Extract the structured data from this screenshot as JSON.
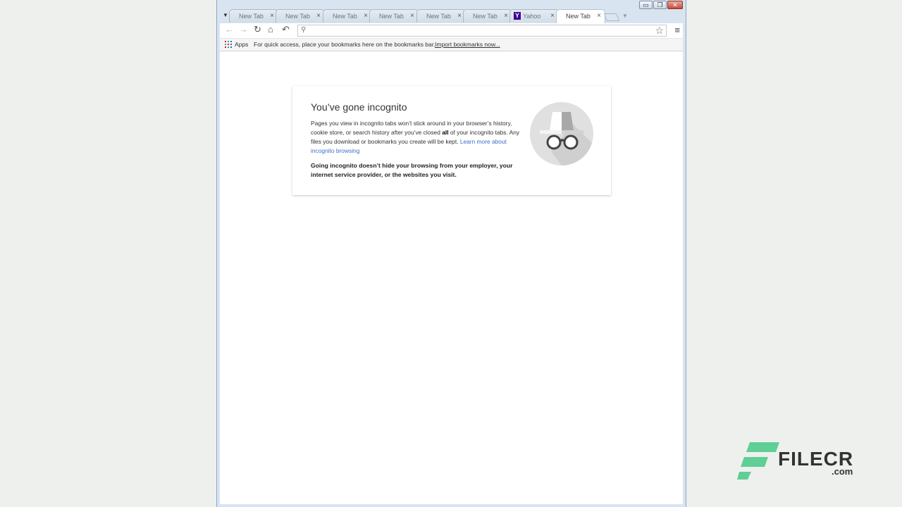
{
  "window": {
    "controls": {
      "minimize": "▭",
      "restore": "❐",
      "close": "✕"
    }
  },
  "tabs": [
    {
      "label": "New Tab",
      "close": "×",
      "active": false
    },
    {
      "label": "New Tab",
      "close": "×",
      "active": false
    },
    {
      "label": "New Tab",
      "close": "×",
      "active": false
    },
    {
      "label": "New Tab",
      "close": "×",
      "active": false
    },
    {
      "label": "New Tab",
      "close": "×",
      "active": false
    },
    {
      "label": "New Tab",
      "close": "×",
      "active": false
    },
    {
      "label": "Yahoo",
      "close": "×",
      "active": false,
      "favicon": "Y"
    },
    {
      "label": "New Tab",
      "close": "×",
      "active": true
    }
  ],
  "toolbar": {
    "back": "←",
    "forward": "→",
    "reload": "↻",
    "home": "⌂",
    "undo": "↶",
    "search_icon": "⚲",
    "star": "☆",
    "menu": "≡",
    "omnibox_value": ""
  },
  "bookmarks_bar": {
    "apps_label": "Apps",
    "hint": "For quick access, place your bookmarks here on the bookmarks bar.",
    "import_link": "Import bookmarks now..."
  },
  "incognito_card": {
    "title": "You’ve gone incognito",
    "para_part1": "Pages you view in incognito tabs won’t stick around in your browser’s history, cookie store, or search history after you’ve closed ",
    "para_bold": "all",
    "para_part2": " of your incognito tabs. Any files you download or bookmarks you create will be kept. ",
    "learn_more": "Learn more about incognito browsing",
    "warning": "Going incognito doesn’t hide your browsing from your employer, your internet service provider, or the websites you visit."
  },
  "watermark": {
    "name": "FILECR",
    "suffix": ".com"
  },
  "colors": {
    "link": "#3a6fc9",
    "watermark_green": "#5fcf95",
    "titlebar": "#d9e4f1"
  }
}
